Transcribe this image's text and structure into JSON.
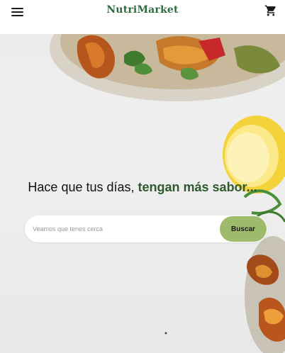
{
  "header": {
    "logo_text": "NutriMarket",
    "menu_icon": "hamburger-menu-icon",
    "cart_icon": "shopping-cart-icon"
  },
  "hero": {
    "headline_regular": "Hace que tus días, ",
    "headline_accent": "tengan más sabor...",
    "search": {
      "placeholder": "Veamos que tenes cerca",
      "value": "",
      "button_label": "Buscar"
    }
  },
  "colors": {
    "brand_green": "#2e6b3f",
    "accent_green": "#2e5a2e",
    "button_green": "#9dbb6a"
  }
}
